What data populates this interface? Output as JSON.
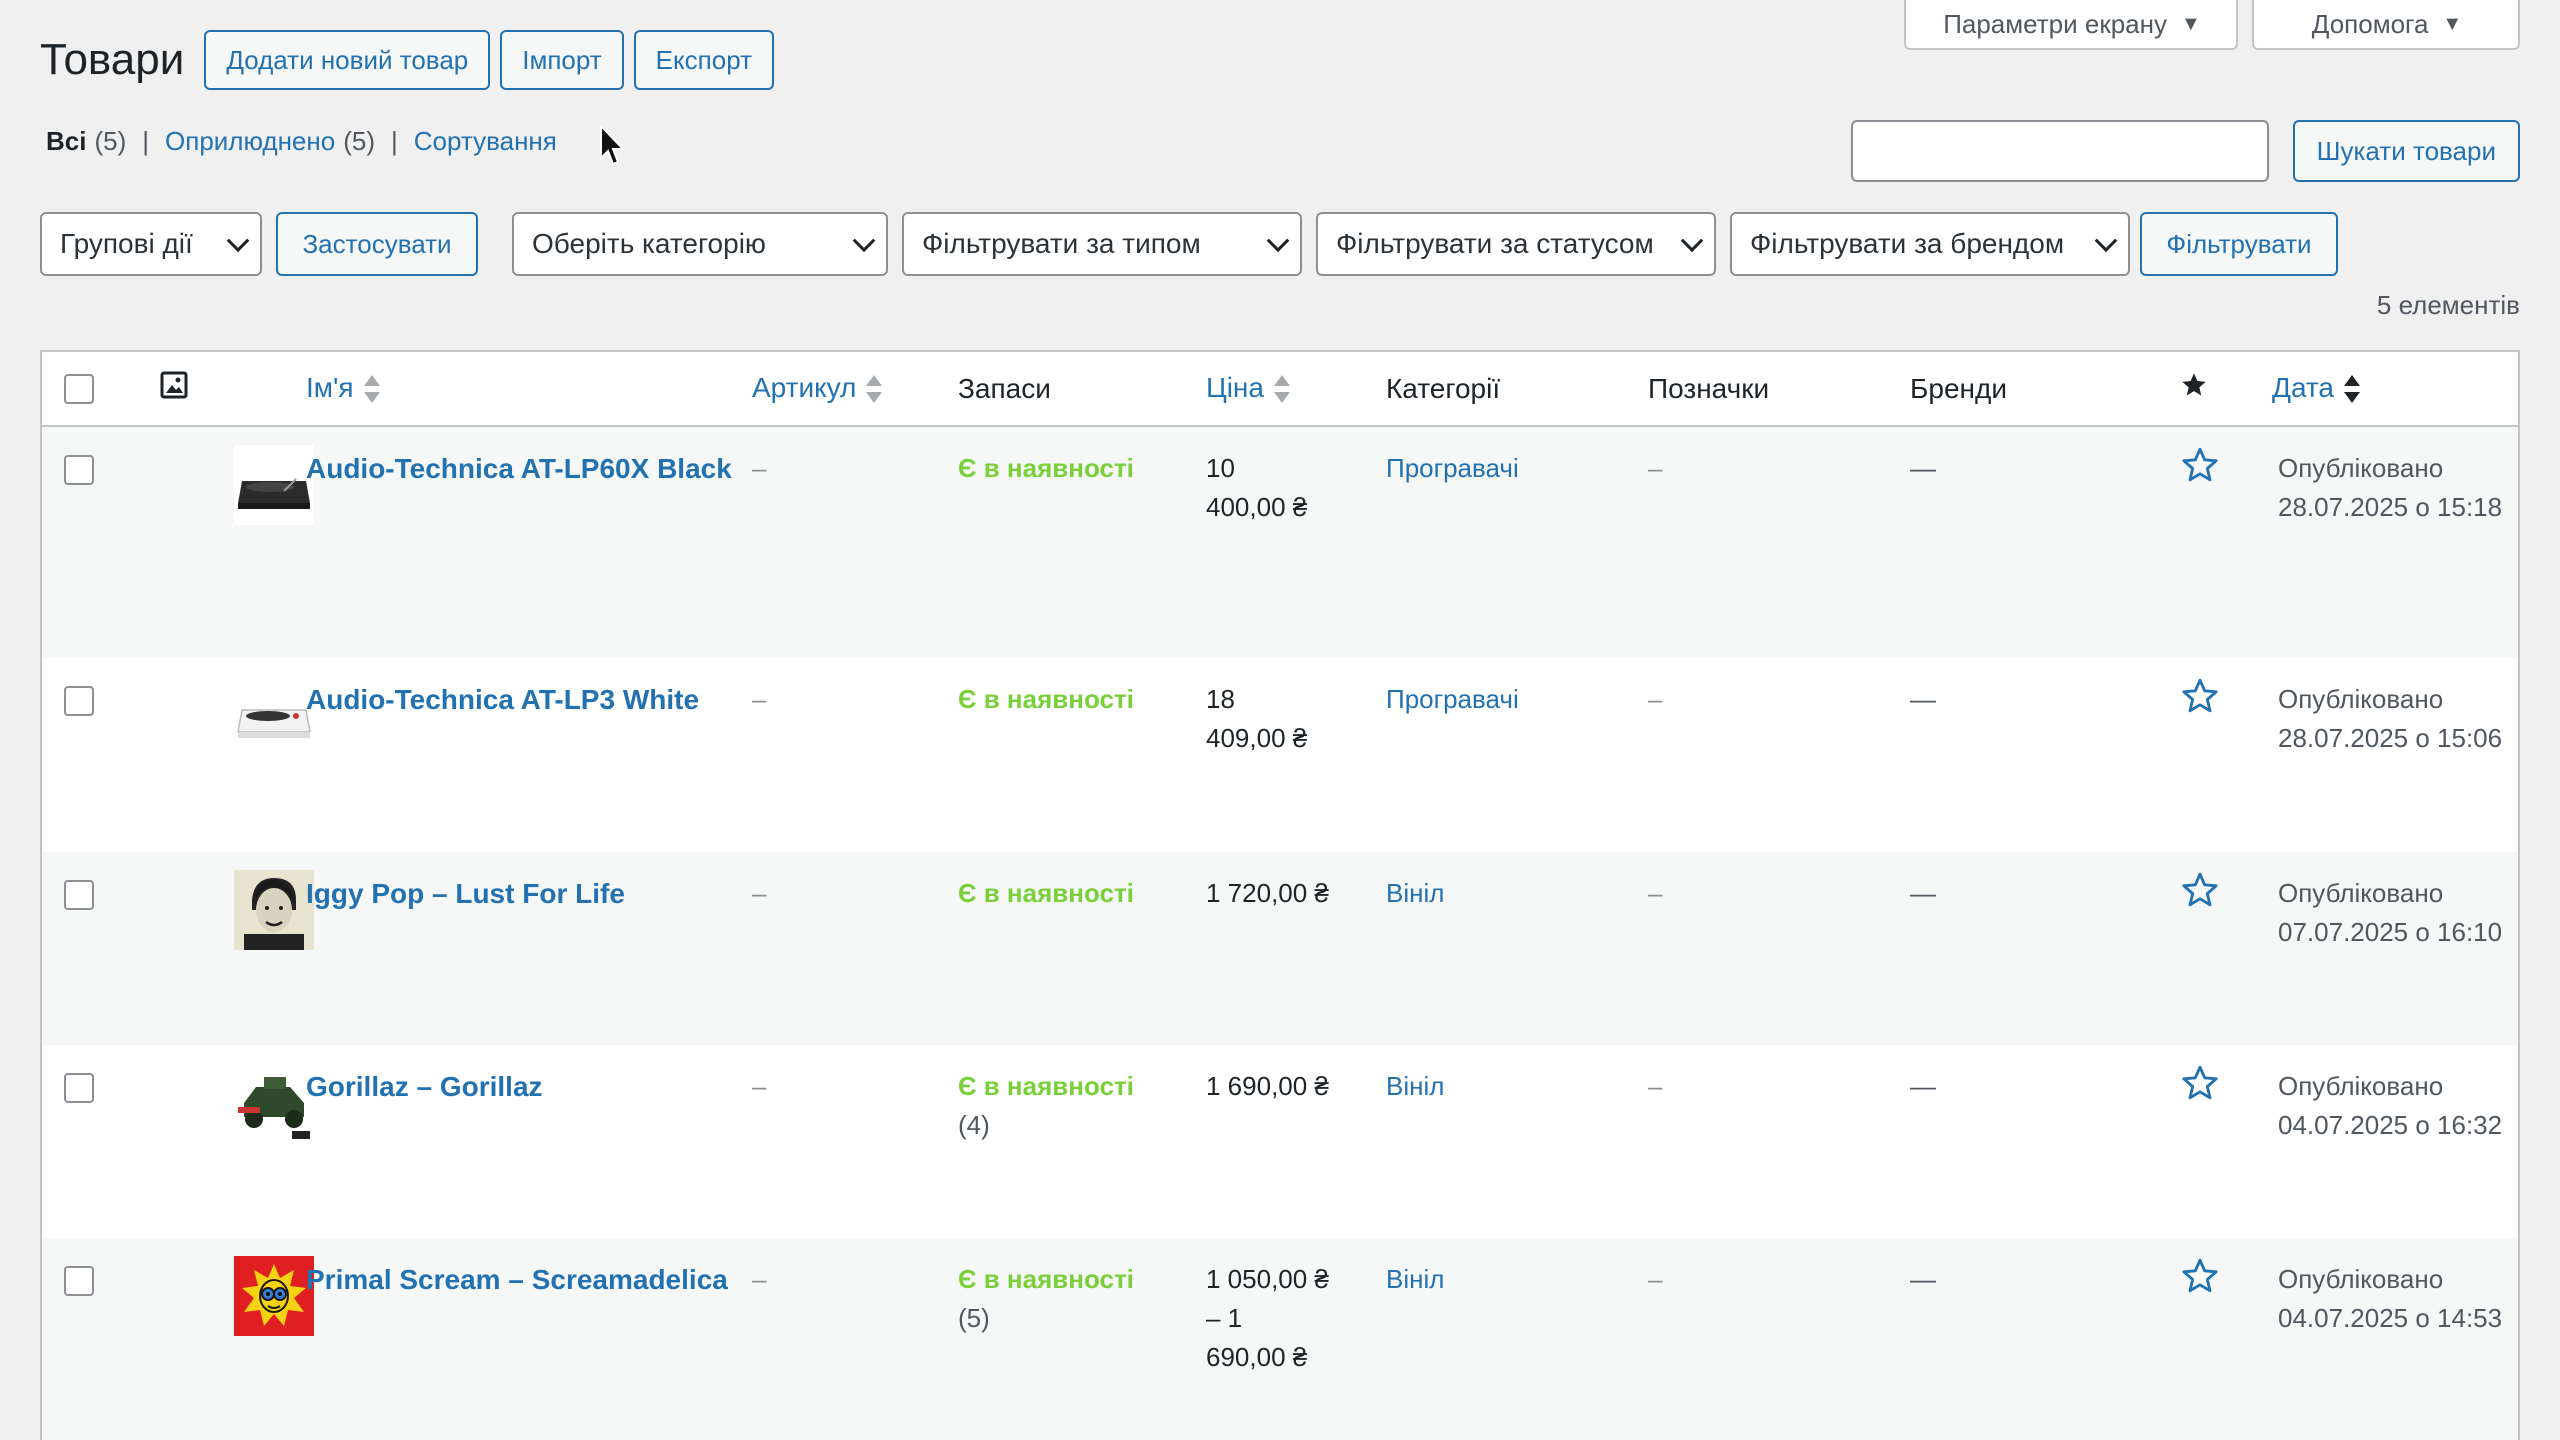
{
  "screen_options": {
    "options_label": "Параметри екрану",
    "help_label": "Допомога"
  },
  "header": {
    "title": "Товари",
    "add_new": "Додати новий товар",
    "import": "Імпорт",
    "export": "Експорт"
  },
  "views": {
    "all_label": "Всі",
    "all_count": "(5)",
    "published_label": "Оприлюднено",
    "published_count": "(5)",
    "sorting_label": "Сортування",
    "separator": "|"
  },
  "search": {
    "value": "",
    "button": "Шукати товари"
  },
  "filters": {
    "bulk_actions": "Групові дії",
    "apply": "Застосувати",
    "category": "Оберіть категорію",
    "type": "Фільтрувати за типом",
    "status": "Фільтрувати за статусом",
    "brand": "Фільтрувати за брендом",
    "filter_button": "Фільтрувати"
  },
  "items_count": "5 елементів",
  "columns": {
    "name": "Ім'я",
    "sku": "Артикул",
    "stock": "Запаси",
    "price": "Ціна",
    "categories": "Категорії",
    "tags": "Позначки",
    "brands": "Бренди",
    "date": "Дата"
  },
  "products": [
    {
      "name": "Audio-Technica AT-LP60X Black",
      "sku": "–",
      "stock": "Є в наявності",
      "stock_count": "",
      "price": [
        "10",
        "400,00 ₴"
      ],
      "category": "Програвачі",
      "tags": "–",
      "brands": "—",
      "status": "Опубліковано",
      "date": "28.07.2025 о 15:18",
      "thumb": "turntable-black"
    },
    {
      "name": "Audio-Technica AT-LP3 White",
      "sku": "–",
      "stock": "Є в наявності",
      "stock_count": "",
      "price": [
        "18",
        "409,00 ₴"
      ],
      "category": "Програвачі",
      "tags": "–",
      "brands": "—",
      "status": "Опубліковано",
      "date": "28.07.2025 о 15:06",
      "thumb": "turntable-white"
    },
    {
      "name": "Iggy Pop – Lust For Life",
      "sku": "–",
      "stock": "Є в наявності",
      "stock_count": "",
      "price": [
        "1 720,00 ₴"
      ],
      "category": "Вініл",
      "tags": "–",
      "brands": "—",
      "status": "Опубліковано",
      "date": "07.07.2025 о 16:10",
      "thumb": "album-iggy"
    },
    {
      "name": "Gorillaz – Gorillaz",
      "sku": "–",
      "stock": "Є в наявності",
      "stock_count": "(4)",
      "price": [
        "1 690,00 ₴"
      ],
      "category": "Вініл",
      "tags": "–",
      "brands": "—",
      "status": "Опубліковано",
      "date": "04.07.2025 о 16:32",
      "thumb": "album-gorillaz"
    },
    {
      "name": "Primal Scream – Screamadelica",
      "sku": "–",
      "stock": "Є в наявності",
      "stock_count": "(5)",
      "price": [
        "1 050,00 ₴",
        "– 1",
        "690,00 ₴"
      ],
      "category": "Вініл",
      "tags": "–",
      "brands": "—",
      "status": "Опубліковано",
      "date": "04.07.2025 о 14:53",
      "thumb": "album-screamadelica"
    }
  ],
  "colors": {
    "link": "#2271b1",
    "in_stock": "#7ad03a",
    "border": "#c3c4c7",
    "background": "#f0f0f1"
  }
}
